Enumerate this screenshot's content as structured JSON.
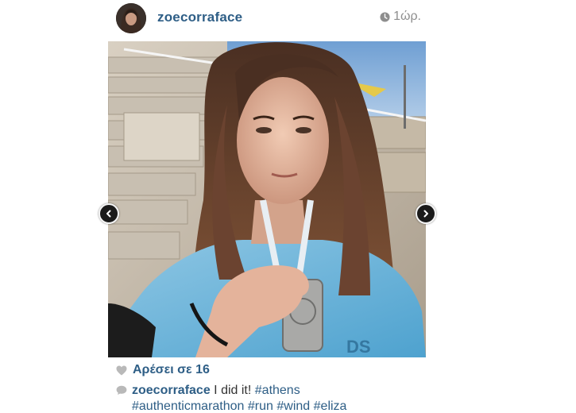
{
  "post": {
    "username": "zoecorraface",
    "timestamp": "1ώρ.",
    "likes_text": "Αρέσει σε 16",
    "caption": {
      "username": "zoecorraface",
      "text": "I did it!",
      "hashtags": [
        "#athens",
        "#authenticmarathon",
        "#run",
        "#wind",
        "#eliza"
      ]
    }
  },
  "icons": {
    "clock": "clock-icon",
    "heart": "heart-icon",
    "comment": "comment-bubble-icon",
    "prev": "chevron-left-icon",
    "next": "chevron-right-icon"
  },
  "colors": {
    "link": "#2e5e86",
    "meta": "#8e8e8e",
    "icon_gray": "#b9b9b9"
  }
}
